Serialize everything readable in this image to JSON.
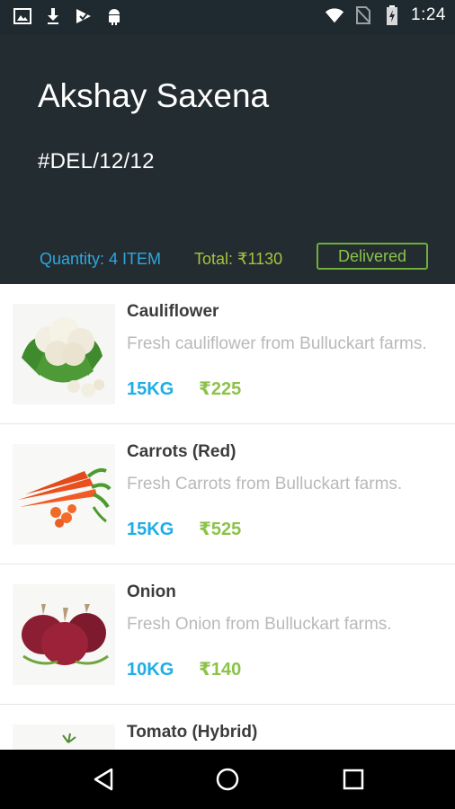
{
  "status_bar": {
    "time": "1:24",
    "icons_left": [
      "image-icon",
      "download-icon",
      "play-store-icon",
      "android-icon"
    ],
    "icons_right": [
      "wifi-icon",
      "no-sim-icon",
      "battery-charging-icon"
    ]
  },
  "header": {
    "customer_name": "Akshay Saxena",
    "order_id": "#DEL/12/12",
    "quantity_label": "Quantity: 4 ITEM",
    "total_label": "Total: ₹1130",
    "status": "Delivered",
    "colors": {
      "background": "#232c31",
      "quantity": "#2ea8e0",
      "total": "#a9c23d",
      "status": "#8bc34a"
    }
  },
  "items": [
    {
      "name": "Cauliflower",
      "description": "Fresh cauliflower from Bulluckart farms.",
      "quantity": "15KG",
      "price": "₹225",
      "image_icon": "cauliflower-image"
    },
    {
      "name": "Carrots (Red)",
      "description": "Fresh Carrots from Bulluckart farms.",
      "quantity": "15KG",
      "price": "₹525",
      "image_icon": "carrots-image"
    },
    {
      "name": "Onion",
      "description": "Fresh Onion from Bulluckart farms.",
      "quantity": "10KG",
      "price": "₹140",
      "image_icon": "onion-image"
    },
    {
      "name": "Tomato (Hybrid)",
      "description": "",
      "quantity": "",
      "price": "",
      "image_icon": "tomato-image"
    }
  ],
  "nav_bar": {
    "buttons": [
      "back-icon",
      "home-icon",
      "recents-icon"
    ]
  }
}
